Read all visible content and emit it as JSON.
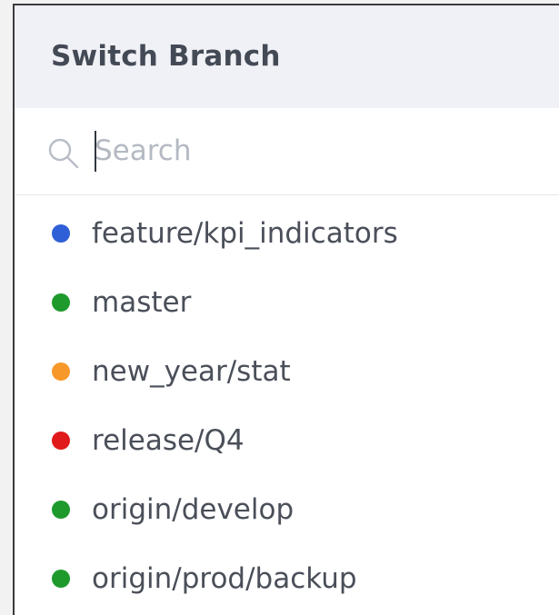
{
  "header": {
    "title": "Switch Branch"
  },
  "search": {
    "placeholder": "Search",
    "value": "",
    "icon": "search-icon"
  },
  "branches": [
    {
      "label": "feature/kpi_indicators",
      "color": "#2f5fd6"
    },
    {
      "label": "master",
      "color": "#1e9a2c"
    },
    {
      "label": "new_year/stat",
      "color": "#f7982a"
    },
    {
      "label": "release/Q4",
      "color": "#e0191b"
    },
    {
      "label": "origin/develop",
      "color": "#1e9a2c"
    },
    {
      "label": "origin/prod/backup",
      "color": "#1e9a2c"
    }
  ]
}
